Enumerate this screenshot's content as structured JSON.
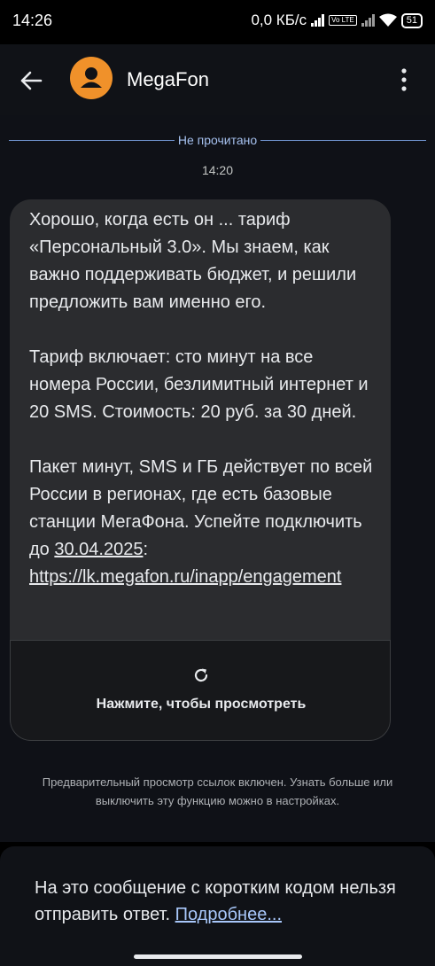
{
  "status_bar": {
    "time": "14:26",
    "network_speed": "0,0 КБ/с",
    "lte_badge": "Vo LTE",
    "battery": "51"
  },
  "header": {
    "contact_name": "MegaFon",
    "avatar_color": "#f0912a"
  },
  "conversation": {
    "unread_divider": "Не прочитано",
    "message_time": "14:20",
    "message": {
      "paragraph_1": "Хорошо, когда есть он ... тариф «Персональный 3.0». Мы знаем, как важно поддерживать бюджет, и решили предложить вам именно его.",
      "paragraph_2": "Тариф включает: сто минут на все номера России, безлимитный интернет и 20 SMS. Стоимость: 20 руб. за 30 дней.",
      "paragraph_3_start": "Пакет минут, SMS и ГБ действует по всей России в регионах, где есть базовые станции МегаФона. Успейте подключить до ",
      "date_link": "30.04.2025",
      "paragraph_3_colon": ":",
      "url": "https://lk.megafon.ru/inapp/engagement"
    },
    "link_preview": {
      "label": "Нажмите, чтобы просмотреть",
      "icon": "refresh-icon"
    },
    "link_preview_note": "Предварительный просмотр ссылок включен. Узнать больше или выключить эту функцию можно в настройках."
  },
  "reply_bar": {
    "text": "На это сообщение с коротким кодом нельзя отправить ответ. ",
    "more_link": "Подробнее..."
  },
  "colors": {
    "accent_link": "#a8c7fa",
    "unread_divider": "#6c8ec8",
    "bubble": "#2b2c2f",
    "background": "#0f1117"
  }
}
